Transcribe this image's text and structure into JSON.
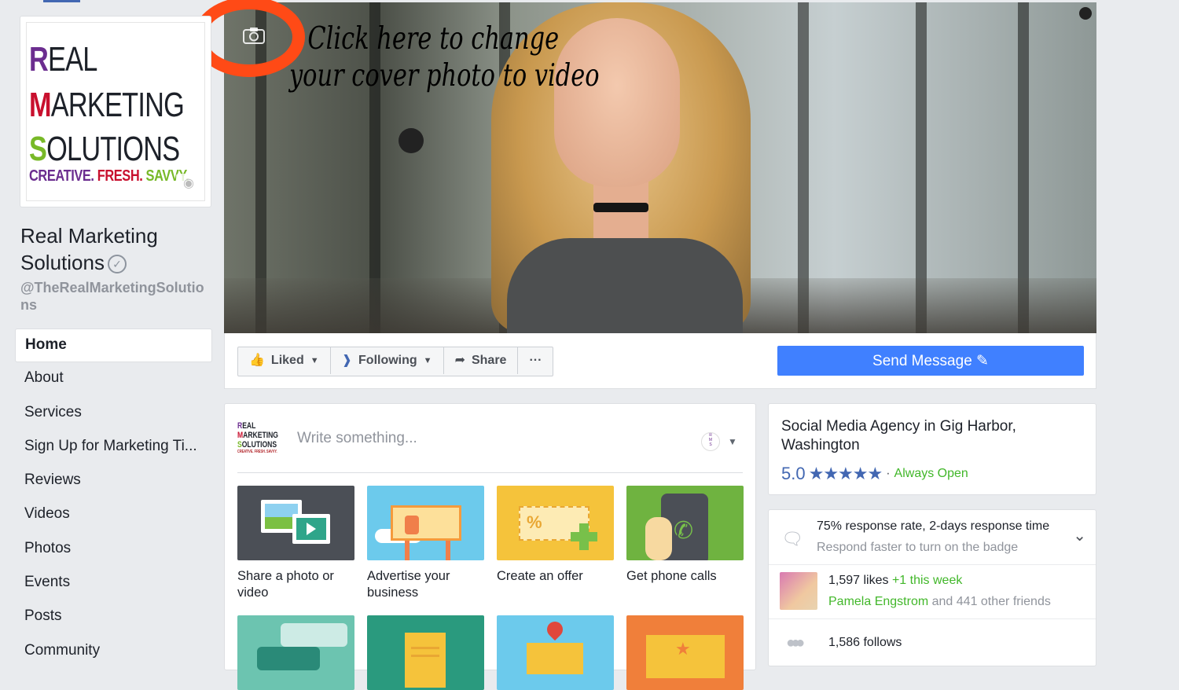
{
  "annotation": {
    "line1": "Click here to change",
    "line2": "your cover photo to video"
  },
  "logo": {
    "line1_big": "R",
    "line1_rest": "EAL",
    "line2_big": "M",
    "line2_rest": "ARKETING",
    "line3_big": "S",
    "line3_rest": "OLUTIONS",
    "tag_part1": "CREATIVE.",
    "tag_part2": "FRESH.",
    "tag_part3": "SAVVY.",
    "colors": {
      "r": "#6b2d8f",
      "m": "#c8102e",
      "s": "#78b928",
      "creative": "#6b2d8f",
      "fresh": "#c8102e",
      "savvy": "#78b928"
    }
  },
  "page": {
    "name": "Real Marketing Solutions",
    "handle": "@TheRealMarketingSolutions"
  },
  "nav": {
    "items": [
      "Home",
      "About",
      "Services",
      "Sign Up for Marketing Ti...",
      "Reviews",
      "Videos",
      "Photos",
      "Events",
      "Posts",
      "Community"
    ]
  },
  "actions": {
    "liked": "Liked",
    "following": "Following",
    "share": "Share",
    "more": "···",
    "send_message": "Send Message"
  },
  "composer": {
    "placeholder": "Write something...",
    "tiles": [
      {
        "label": "Share a photo or video"
      },
      {
        "label": "Advertise your business"
      },
      {
        "label": "Create an offer"
      },
      {
        "label": "Get phone calls"
      }
    ]
  },
  "about": {
    "category": "Social Media Agency in Gig Harbor, Washington",
    "rating": "5.0",
    "stars": "★★★★★",
    "dot": "·",
    "hours": "Always Open"
  },
  "stats": {
    "response_line1": "75% response rate, 2-days response time",
    "response_line2": "Respond faster to turn on the badge",
    "likes_count": "1,597 likes",
    "likes_week": "+1 this week",
    "friend_name": "Pamela Engstrom",
    "friend_rest": "and 441 other friends",
    "follows": "1,586 follows"
  },
  "colors": {
    "accent": "#4267b2",
    "send_button": "#4080ff",
    "green": "#42b72a",
    "annotation_circle": "#ff4a16"
  }
}
